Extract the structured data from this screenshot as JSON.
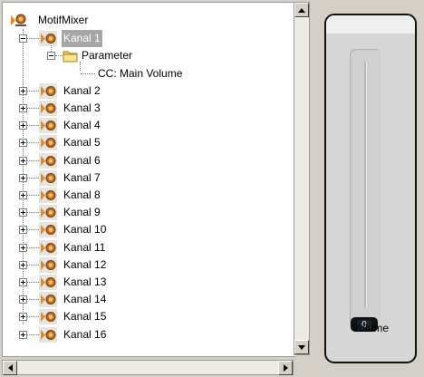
{
  "tree": {
    "root": {
      "label": "MotifMixer"
    },
    "selected": "Kanal 1",
    "kanal1_children": {
      "parameter": {
        "label": "Parameter"
      },
      "cc": {
        "label": "CC: Main Volume"
      }
    },
    "channels": [
      "Kanal 1",
      "Kanal 2",
      "Kanal 3",
      "Kanal 4",
      "Kanal 5",
      "Kanal 6",
      "Kanal 7",
      "Kanal 8",
      "Kanal 9",
      "Kanal 10",
      "Kanal 11",
      "Kanal 12",
      "Kanal 13",
      "Kanal 14",
      "Kanal 15",
      "Kanal 16"
    ]
  },
  "volume": {
    "label": "Volume",
    "value": "0",
    "level_fraction": 0
  },
  "icons": {
    "node": "midi-plug-icon",
    "folder": "folder-icon",
    "expand": "plus-box-icon",
    "collapse": "minus-box-icon"
  },
  "colors": {
    "selection": "#a6a6a6",
    "plug_orange": "#e58a22",
    "panel_background": "#d4d0c8"
  }
}
